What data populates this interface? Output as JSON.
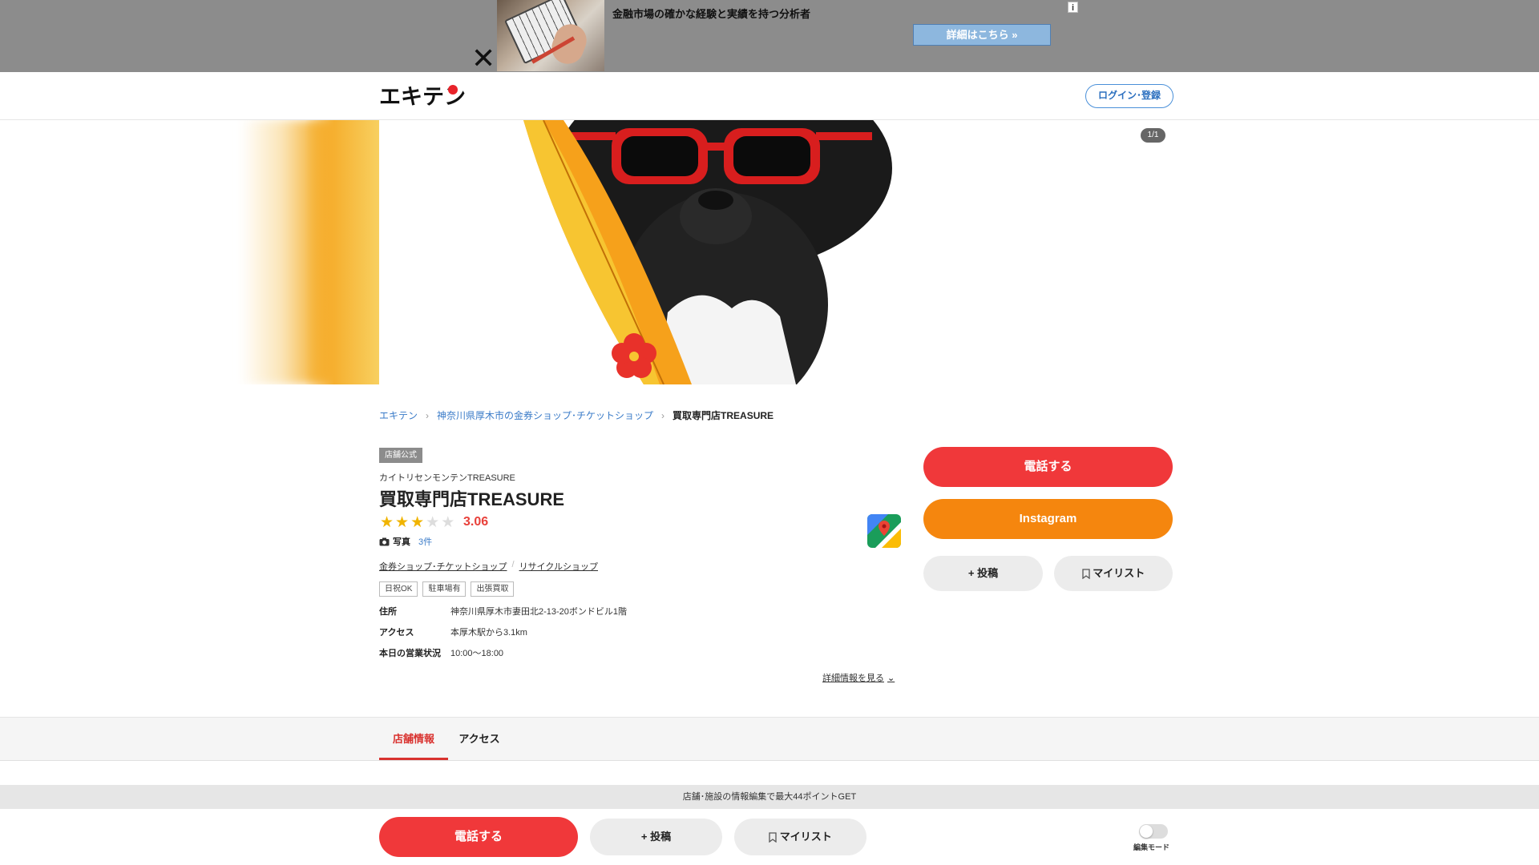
{
  "ad": {
    "headline": "金融市場の確かな経験と実績を持つ分析者",
    "cta": "詳細はこちら »",
    "close_icon": "close-icon",
    "info_badge": "i"
  },
  "header": {
    "logo_text": "エキテン",
    "login_label": "ログイン･登録"
  },
  "hero": {
    "counter": "1/1"
  },
  "breadcrumb": {
    "items": [
      "エキテン",
      "神奈川県厚木市の金券ショップ･チケットショップ"
    ],
    "current": "買取専門店TREASURE"
  },
  "store": {
    "official_badge": "店舗公式",
    "kana": "カイトリセンモンテンTREASURE",
    "name": "買取専門店TREASURE",
    "rating": "3.06",
    "rating_value": 3.06,
    "rating_max": 5,
    "photos_label": "写真",
    "photos_count": "3件",
    "categories": [
      "金券ショップ･チケットショップ",
      "リサイクルショップ"
    ],
    "tags": [
      "日祝OK",
      "駐車場有",
      "出張買取"
    ],
    "address_label": "住所",
    "address": "神奈川県厚木市妻田北2-13-20ボンドビル1階",
    "access_label": "アクセス",
    "access": "本厚木駅から3.1km",
    "hours_label": "本日の営業状況",
    "hours": "10:00〜18:00",
    "more_link": "詳細情報を見る"
  },
  "actions": {
    "call": "電話する",
    "instagram": "Instagram",
    "post": "投稿",
    "mylist": "マイリスト"
  },
  "tabs": [
    {
      "label": "店舗情報",
      "active": true
    },
    {
      "label": "アクセス",
      "active": false
    }
  ],
  "bottom": {
    "promo": "店舗･施設の情報編集で最大44ポイントGET",
    "call": "電話する",
    "post": "投稿",
    "mylist": "マイリスト",
    "edit_mode": "編集モード"
  },
  "colors": {
    "brand_red": "#f0383a",
    "instagram_orange": "#f5860e",
    "link_blue": "#3a7bc8",
    "star_gold": "#f0b400"
  }
}
